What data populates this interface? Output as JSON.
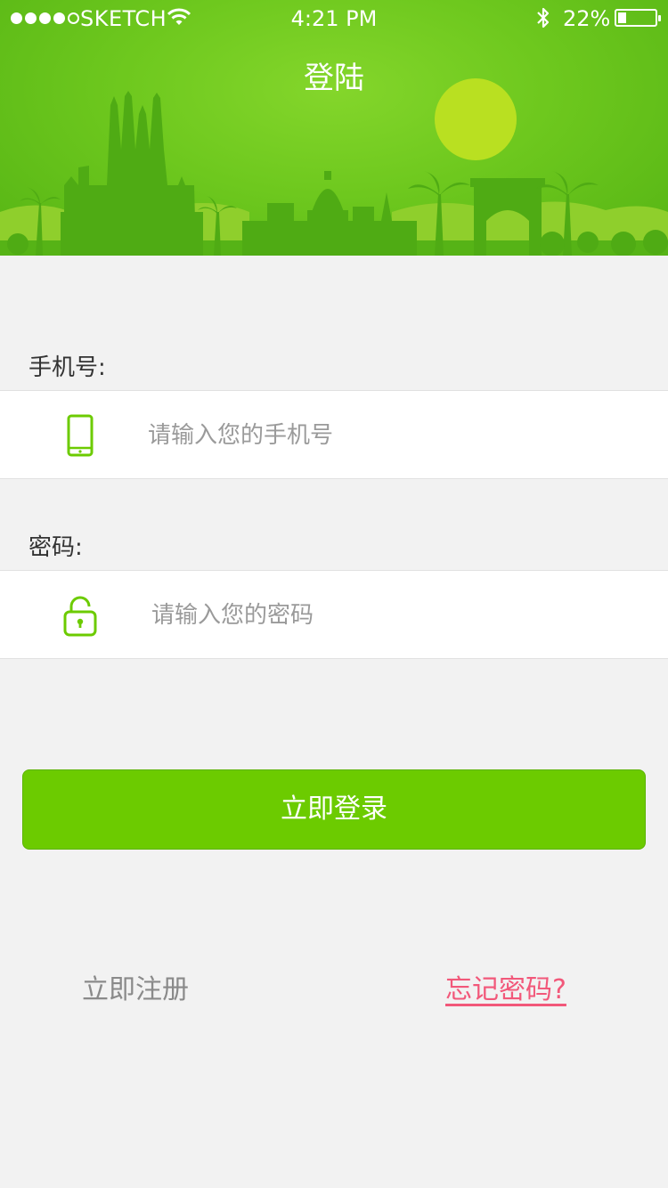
{
  "statusbar": {
    "carrier": "SKETCH",
    "time": "4:21 PM",
    "battery_percent": "22%",
    "battery_level": 0.22,
    "signal_dots_filled": 4,
    "icons": [
      "wifi-icon",
      "bluetooth-icon",
      "battery-icon"
    ]
  },
  "header": {
    "title": "登陆"
  },
  "form": {
    "phone_label": "手机号:",
    "phone_placeholder": "请输入您的手机号",
    "phone_value": "",
    "phone_icon": "mobile-phone-icon",
    "password_label": "密码:",
    "password_placeholder": "请输入您的密码",
    "password_value": "",
    "password_icon": "unlock-icon"
  },
  "actions": {
    "login_label": "立即登录",
    "register_label": "立即注册",
    "forgot_label": "忘记密码?"
  },
  "colors": {
    "accent_green": "#6ccb00",
    "forgot_link": "#f2587a",
    "background": "#f2f2f2"
  }
}
